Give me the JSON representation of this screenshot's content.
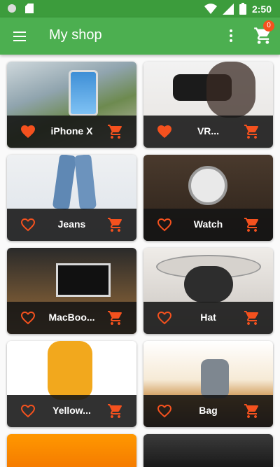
{
  "status_bar": {
    "time": "2:50",
    "icons": [
      "circle-icon",
      "sd-card-icon",
      "wifi-icon",
      "signal-icon",
      "battery-icon"
    ]
  },
  "app_bar": {
    "title": "My shop",
    "cart_count": "0",
    "icons": [
      "menu-icon",
      "more-vert-icon",
      "shopping-cart-icon"
    ]
  },
  "colors": {
    "primary": "#4caf50",
    "primary_dark": "#3c9c3c",
    "accent": "#f4511e",
    "tile_bar": "#141414"
  },
  "products": [
    {
      "name": "iPhone X",
      "favorite": true
    },
    {
      "name": "VR...",
      "favorite": true
    },
    {
      "name": "Jeans",
      "favorite": false
    },
    {
      "name": "Watch",
      "favorite": false
    },
    {
      "name": "MacBoo...",
      "favorite": false
    },
    {
      "name": "Hat",
      "favorite": false
    },
    {
      "name": "Yellow...",
      "favorite": false
    },
    {
      "name": "Bag",
      "favorite": false
    },
    {
      "name": "",
      "favorite": false
    },
    {
      "name": "",
      "favorite": false
    }
  ]
}
